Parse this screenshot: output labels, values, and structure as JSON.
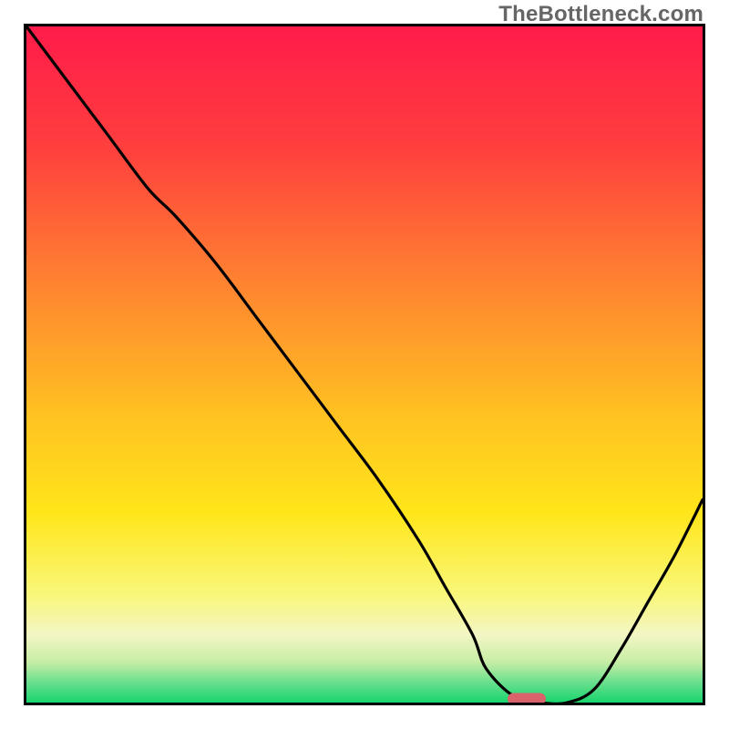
{
  "watermark": "TheBottleneck.com",
  "chart_data": {
    "type": "line",
    "title": "",
    "xlabel": "",
    "ylabel": "",
    "xlim": [
      0,
      100
    ],
    "ylim": [
      0,
      100
    ],
    "grid": false,
    "legend": false,
    "gradient_stops": [
      {
        "pct": 0,
        "color": "#ff1b4a"
      },
      {
        "pct": 18,
        "color": "#ff3f3e"
      },
      {
        "pct": 40,
        "color": "#ff8a2f"
      },
      {
        "pct": 58,
        "color": "#ffc321"
      },
      {
        "pct": 72,
        "color": "#ffe61a"
      },
      {
        "pct": 84,
        "color": "#f9f77a"
      },
      {
        "pct": 90,
        "color": "#f3f6c4"
      },
      {
        "pct": 94,
        "color": "#c7eda5"
      },
      {
        "pct": 97,
        "color": "#6adf8e"
      },
      {
        "pct": 100,
        "color": "#18d56e"
      }
    ],
    "series": [
      {
        "name": "bottleneck-curve",
        "x": [
          0,
          6,
          12,
          18,
          22,
          28,
          34,
          40,
          46,
          52,
          58,
          62,
          66,
          68,
          72,
          76,
          80,
          84,
          88,
          92,
          96,
          100
        ],
        "y": [
          100,
          92,
          84,
          76,
          72,
          65,
          57,
          49,
          41,
          33,
          24,
          17,
          10,
          5,
          1,
          0,
          0,
          2,
          8,
          15,
          22,
          30
        ]
      }
    ],
    "marker": {
      "x": 74,
      "y": 0.5,
      "color": "#d9626b"
    }
  }
}
